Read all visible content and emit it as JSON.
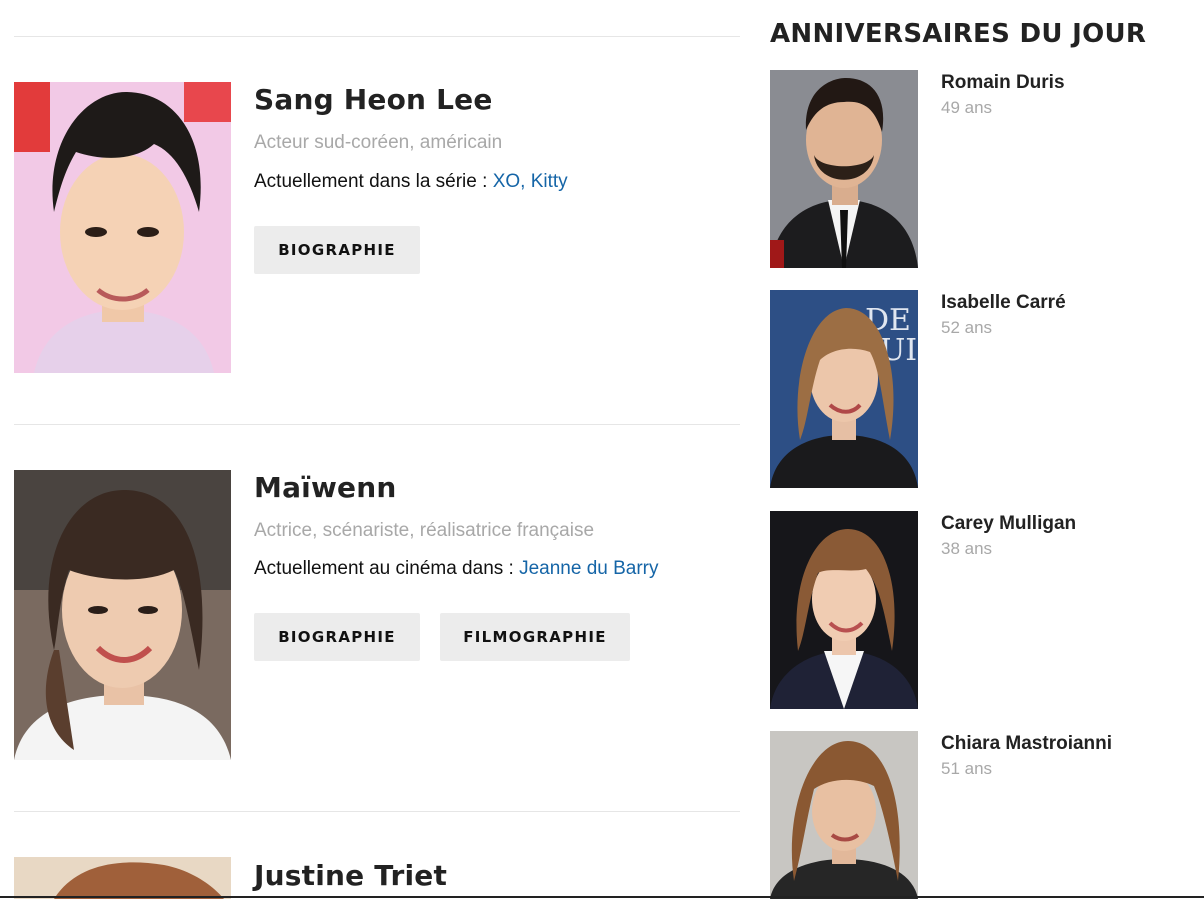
{
  "people": [
    {
      "name": "Sang Heon Lee",
      "role": "Acteur sud-coréen, américain",
      "current_prefix": "Actuellement dans la série : ",
      "current_link": "XO, Kitty",
      "buttons": [
        "BIOGRAPHIE"
      ]
    },
    {
      "name": "Maïwenn",
      "role": "Actrice, scénariste, réalisatrice française",
      "current_prefix": "Actuellement au cinéma dans : ",
      "current_link": "Jeanne du Barry",
      "buttons": [
        "BIOGRAPHIE",
        "FILMOGRAPHIE"
      ]
    },
    {
      "name": "Justine Triet"
    }
  ],
  "sidebar": {
    "title": "ANNIVERSAIRES DU JOUR",
    "items": [
      {
        "name": "Romain Duris",
        "age": "49 ans"
      },
      {
        "name": "Isabelle Carré",
        "age": "52 ans"
      },
      {
        "name": "Carey Mulligan",
        "age": "38 ans"
      },
      {
        "name": "Chiara Mastroianni",
        "age": "51 ans"
      }
    ]
  },
  "colors": {
    "link": "#1565a7",
    "muted": "#a8a8a8",
    "button_bg": "#ececec",
    "divider": "#e6e6e6"
  }
}
